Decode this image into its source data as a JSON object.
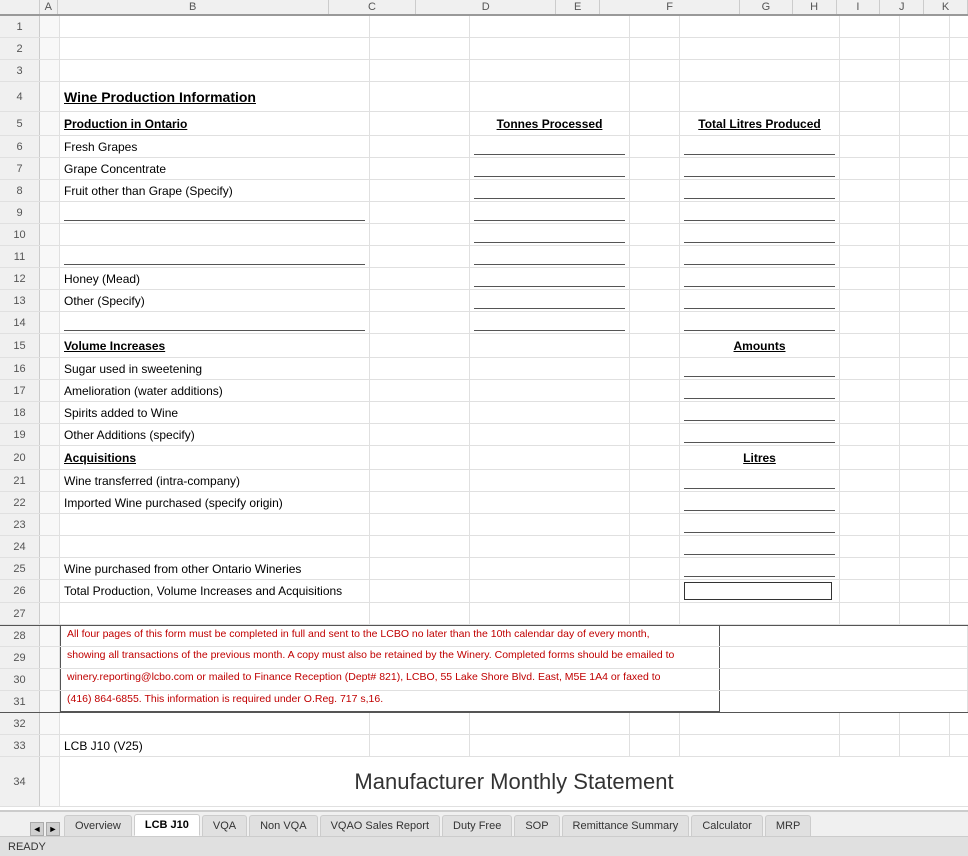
{
  "title": "Wine Production Information",
  "main_title": "Manufacturer Monthly Statement",
  "status": "READY",
  "cols": [
    "A",
    "B",
    "C",
    "D",
    "E",
    "F",
    "G",
    "H",
    "I",
    "J",
    "K"
  ],
  "rows": {
    "r4": {
      "num": "4",
      "b": "Wine Production Information"
    },
    "r5": {
      "num": "5",
      "b": "Production in Ontario",
      "d": "Tonnes Processed",
      "f": "Total Litres Produced"
    },
    "r6": {
      "num": "6",
      "b": "Fresh Grapes"
    },
    "r7": {
      "num": "7",
      "b": "Grape Concentrate"
    },
    "r8": {
      "num": "8",
      "b": "Fruit other than Grape (Specify)"
    },
    "r9": {
      "num": "9"
    },
    "r10": {
      "num": "10"
    },
    "r11": {
      "num": "11"
    },
    "r12": {
      "num": "12",
      "b": "Honey (Mead)"
    },
    "r13": {
      "num": "13",
      "b": "Other (Specify)"
    },
    "r14": {
      "num": "14"
    },
    "r15": {
      "num": "15",
      "b": "Volume Increases",
      "f": "Amounts"
    },
    "r16": {
      "num": "16",
      "b": "Sugar used in sweetening"
    },
    "r17": {
      "num": "17",
      "b": "Amelioration (water additions)"
    },
    "r18": {
      "num": "18",
      "b": "Spirits added to Wine"
    },
    "r19": {
      "num": "19",
      "b": "Other Additions (specify)"
    },
    "r20": {
      "num": "20",
      "b": "Acquisitions",
      "f": "Litres"
    },
    "r21": {
      "num": "21",
      "b": "Wine transferred (intra-company)"
    },
    "r22": {
      "num": "22",
      "b": "Imported Wine purchased (specify origin)"
    },
    "r23": {
      "num": "23"
    },
    "r24": {
      "num": "24"
    },
    "r25": {
      "num": "25",
      "b": "Wine purchased from other Ontario Wineries"
    },
    "r26": {
      "num": "26",
      "b": "Total Production, Volume Increases and Acquisitions"
    },
    "r27": {
      "num": "27"
    },
    "r28": {
      "num": "28",
      "notice": "All four pages of this form must be completed in full and sent to the LCBO no later than the 10th calendar day of every month,"
    },
    "r29": {
      "num": "29",
      "notice": "showing all transactions of the previous month. A copy must also be retained by the Winery. Completed forms should be emailed to"
    },
    "r30": {
      "num": "30",
      "notice": "winery.reporting@lcbo.com or mailed to Finance Reception (Dept# 821), LCBO, 55 Lake Shore Blvd. East, M5E 1A4 or faxed to"
    },
    "r31": {
      "num": "31",
      "notice": "(416) 864-6855. This information is required under O.Reg. 717 s,16."
    },
    "r33": {
      "num": "33",
      "b": "LCB J10 (V25)"
    },
    "r34": {
      "num": "34"
    }
  },
  "tabs": [
    {
      "label": "Overview",
      "active": false
    },
    {
      "label": "LCB J10",
      "active": true
    },
    {
      "label": "VQA",
      "active": false
    },
    {
      "label": "Non VQA",
      "active": false
    },
    {
      "label": "VQAO Sales Report",
      "active": false
    },
    {
      "label": "Duty Free",
      "active": false
    },
    {
      "label": "SOP",
      "active": false
    },
    {
      "label": "Remittance Summary",
      "active": false
    },
    {
      "label": "Calculator",
      "active": false
    },
    {
      "label": "MRP",
      "active": false
    }
  ]
}
